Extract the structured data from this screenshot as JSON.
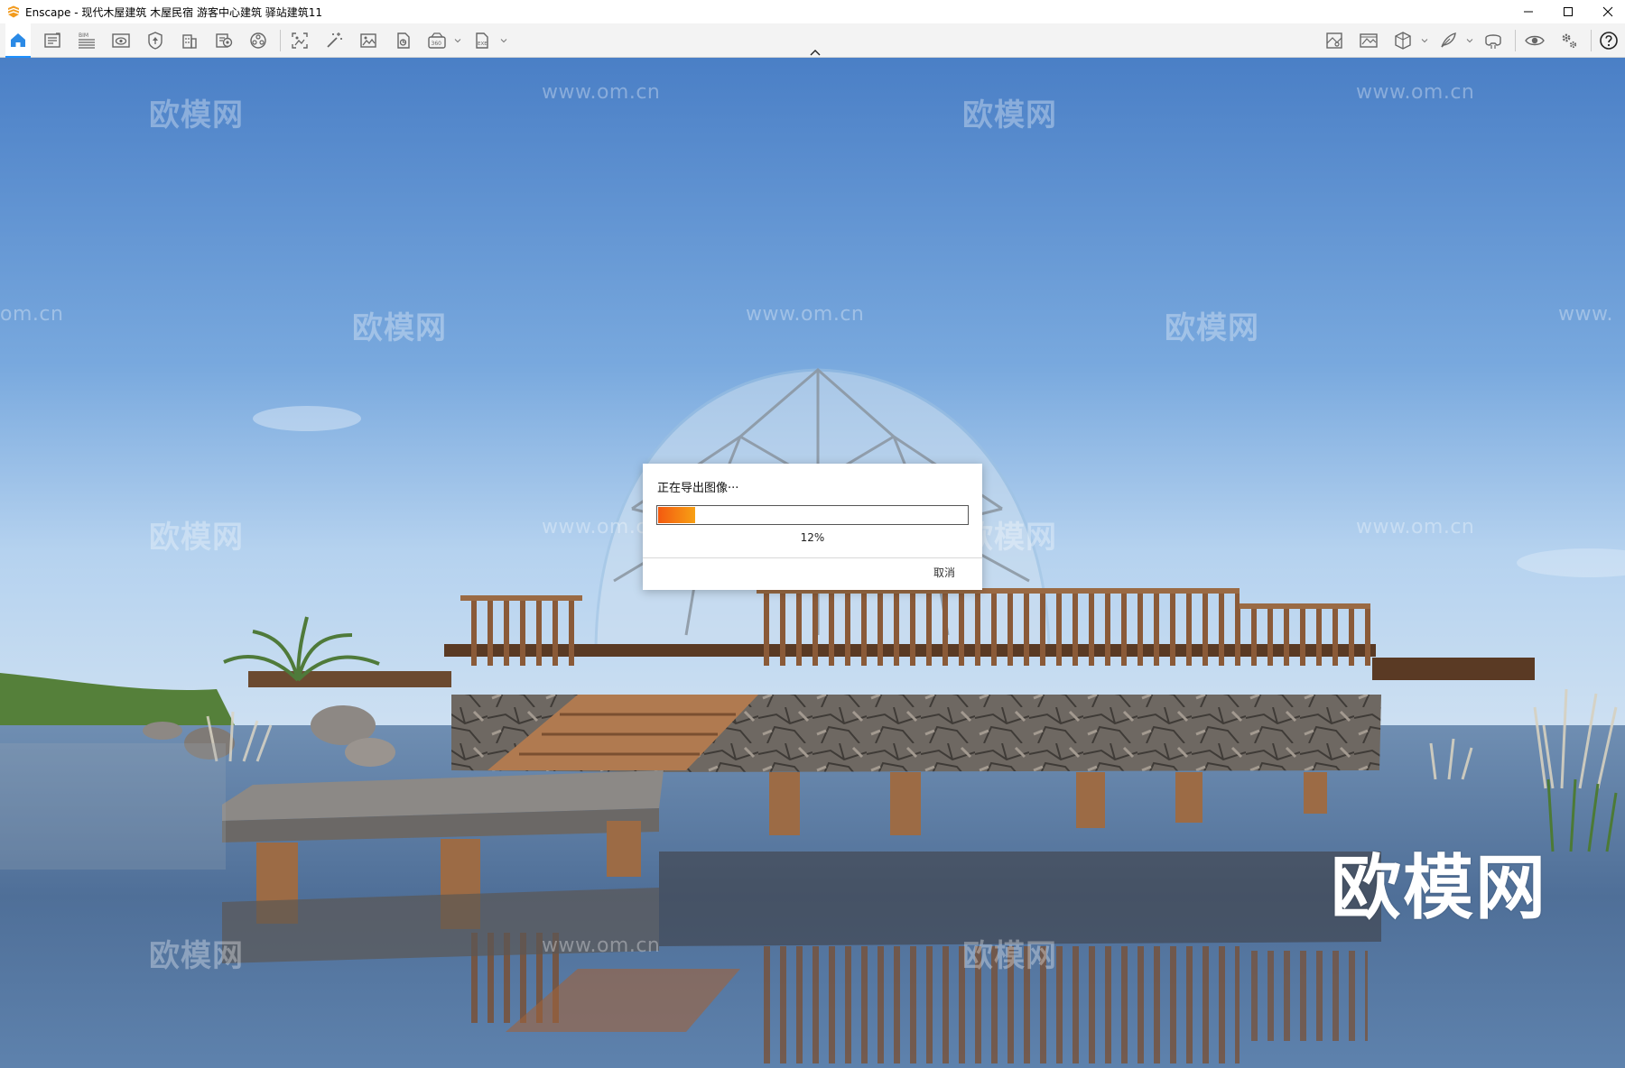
{
  "window": {
    "title": "Enscape - 现代木屋建筑 木屋民宿 游客中心建筑 驿站建筑11",
    "controls": [
      "minimize-icon",
      "maximize-icon",
      "close-icon"
    ]
  },
  "toolbar": {
    "left_tools": [
      "home-icon",
      "asset-library-icon",
      "bim-icon",
      "view-icon",
      "site-context-icon",
      "building-icon",
      "material-editor-icon",
      "atmosphere-icon",
      "screenshot-icon",
      "magic-wand-icon",
      "render-image-icon",
      "export-panorama-icon",
      "video-360-icon",
      "export-exe-icon"
    ],
    "right_tools": [
      "map-icon",
      "image-settings-icon",
      "section-cube-icon",
      "feather-icon",
      "vr-headset-icon",
      "visual-settings-icon",
      "settings-gear-icon",
      "help-icon"
    ]
  },
  "viewport": {
    "watermark_text": "欧模网",
    "watermark_url": "www.om.cn",
    "watermark_url_partial_left": "om.cn",
    "watermark_url_partial_right": "www.",
    "brand_watermark": "欧模网"
  },
  "dialog": {
    "message": "正在导出图像···",
    "progress": 0.12,
    "progress_text": "12%",
    "cancel_label": "取消"
  },
  "colors": {
    "accent": "#1e90ff",
    "progress_start": "#f35a10",
    "progress_end": "#f7a014"
  }
}
